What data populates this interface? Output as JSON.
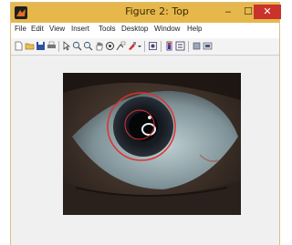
{
  "window": {
    "title": "Figure 2: Top",
    "minimize": "‒",
    "maximize": "☐",
    "close": "✕"
  },
  "menu": [
    "File",
    "Edit",
    "View",
    "Insert",
    "Tools",
    "Desktop",
    "Window",
    "Help"
  ],
  "toolbar": {
    "icons": [
      "new-figure-icon",
      "open-file-icon",
      "save-icon",
      "print-icon",
      "pointer-icon",
      "zoom-in-icon",
      "zoom-out-icon",
      "pan-icon",
      "rotate-icon",
      "data-cursor-icon",
      "brush-icon",
      "link-icon",
      "colorbar-icon",
      "legend-icon",
      "hide-plot-tools-icon",
      "show-plot-tools-icon"
    ]
  },
  "colors": {
    "titlebar": "#e6b84c",
    "close_button": "#c9332b",
    "circle_outline": "#e03030"
  },
  "figure": {
    "image": "eye-closeup-with-detected-iris-circle"
  }
}
